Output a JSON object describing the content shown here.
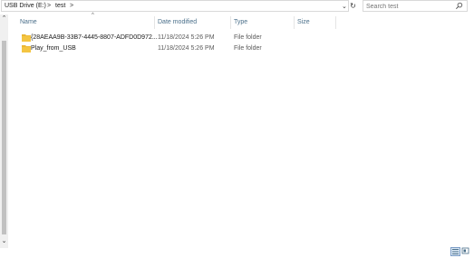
{
  "address": {
    "crumbs": [
      "USB Drive (E:)",
      "test"
    ],
    "separator": ">"
  },
  "search": {
    "placeholder": "Search test"
  },
  "columns": {
    "name": "Name",
    "date": "Date modified",
    "type": "Type",
    "size": "Size"
  },
  "files": [
    {
      "name": "{28AEAA9B-33B7-4445-8807-ADFD0D972...",
      "date": "11/18/2024 5:26 PM",
      "type": "File folder",
      "size": ""
    },
    {
      "name": "Play_from_USB",
      "date": "11/18/2024 5:26 PM",
      "type": "File folder",
      "size": ""
    }
  ],
  "colors": {
    "folder": "#f4c542",
    "header_text": "#4a6f8a",
    "active_view": "#dbe8f5"
  },
  "icons": {
    "folder": "folder-icon",
    "search": "search-icon",
    "refresh": "refresh-icon"
  }
}
